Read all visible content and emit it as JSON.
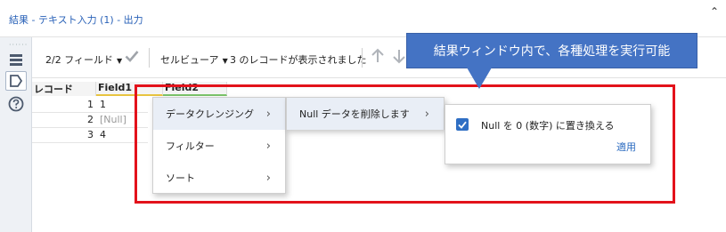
{
  "window": {
    "title": "結果 - テキスト入力 (1) - 出力"
  },
  "toolbar": {
    "fields_label": "2/2 フィールド",
    "viewer_label": "セルビューア",
    "records_text": "3 のレコードが表示されました"
  },
  "grid": {
    "headers": {
      "record": "レコード",
      "field1": "Field1",
      "field2": "Field2"
    },
    "rows": [
      {
        "num": "1",
        "field1": "1"
      },
      {
        "num": "2",
        "field1": "[Null]"
      },
      {
        "num": "3",
        "field1": "4"
      }
    ]
  },
  "context_menu": {
    "items": [
      {
        "label": "データクレンジング"
      },
      {
        "label": "フィルター"
      },
      {
        "label": "ソート"
      }
    ],
    "submenu": {
      "label": "Null データを削除します"
    },
    "option": {
      "label": "Null を 0 (数字) に置き換える",
      "checked": true,
      "apply_label": "適用"
    }
  },
  "callout": {
    "text": "結果ウィンドウ内で、各種処理を実行可能",
    "color": "#4473c4"
  },
  "highlight_color": "#e3121b",
  "icons": [
    "collapse-icon",
    "list-icon",
    "tag-icon",
    "help-icon",
    "checkmark-icon",
    "chevron-down-icon",
    "arrow-up-icon",
    "arrow-down-icon",
    "chevron-right-icon"
  ]
}
